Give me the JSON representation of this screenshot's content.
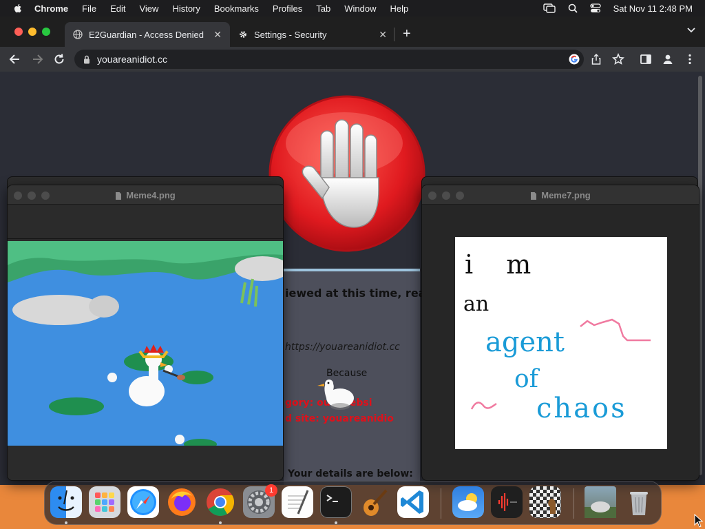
{
  "menubar": {
    "app_name": "Chrome",
    "items": [
      "File",
      "Edit",
      "View",
      "History",
      "Bookmarks",
      "Profiles",
      "Tab",
      "Window",
      "Help"
    ],
    "clock": "Sat Nov 11  2:48 PM"
  },
  "browser": {
    "tabs": [
      {
        "title": "E2Guardian - Access Denied",
        "icon": "globe-icon",
        "active": true
      },
      {
        "title": "Settings - Security",
        "icon": "gear-icon",
        "active": false
      }
    ],
    "url": "youareanidiot.cc"
  },
  "page": {
    "sign_icon": "stop-hand-icon",
    "line_reason": "iewed at this time, rea",
    "line_url": "https://youareanidiot.cc",
    "line_because": "Because",
    "line_category": "gory:  ous Websi",
    "line_site": "d site: youareanidio",
    "line_details": "Your details are below:"
  },
  "preview_windows": [
    {
      "title": "Meme4.png",
      "image": "goose-in-pond-with-crown"
    },
    {
      "title": "Meme7.png",
      "image": "handwritten-note",
      "note_lines": [
        "i m",
        "an",
        "agent",
        "of",
        "chaos"
      ]
    }
  ],
  "dock": {
    "apps": [
      "Finder",
      "Launchpad",
      "Safari",
      "Firefox",
      "Chrome",
      "System Settings",
      "TextEdit",
      "Terminal",
      "GarageBand",
      "Visual Studio Code",
      "Weather",
      "Voice Memos",
      "Chess",
      "Photo",
      "Trash"
    ],
    "settings_badge": "1"
  },
  "colors": {
    "menubar_bg": "#1d1d1f",
    "chrome_bg": "#202124",
    "stop_red": "#e01a1f",
    "alert_red": "#e0101a",
    "note_blue": "#1a9bd7",
    "note_pink": "#f07aa0"
  }
}
